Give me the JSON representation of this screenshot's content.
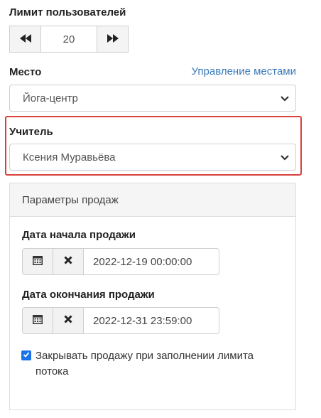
{
  "user_limit": {
    "label": "Лимит пользователей",
    "value": "20"
  },
  "place": {
    "label": "Место",
    "manage_link": "Управление местами",
    "selected": "Йога-центр"
  },
  "teacher": {
    "label": "Учитель",
    "selected": "Ксения Муравьёва"
  },
  "sales_panel": {
    "title": "Параметры продаж",
    "start_label": "Дата начала продажи",
    "start_value": "2022-12-19 00:00:00",
    "end_label": "Дата окончания продажи",
    "end_value": "2022-12-31 23:59:00",
    "close_on_limit_label": "Закрывать продажу при заполнении лимита потока",
    "close_on_limit_checked": true
  },
  "icons": {
    "decrement": "double-left-arrow-icon",
    "increment": "double-right-arrow-icon",
    "calendar": "calendar-icon",
    "clear": "clear-x-icon",
    "dropdown": "chevron-down-icon"
  },
  "colors": {
    "link": "#3a7ab8",
    "highlight": "#d9413c",
    "checkbox": "#1a73e8"
  }
}
